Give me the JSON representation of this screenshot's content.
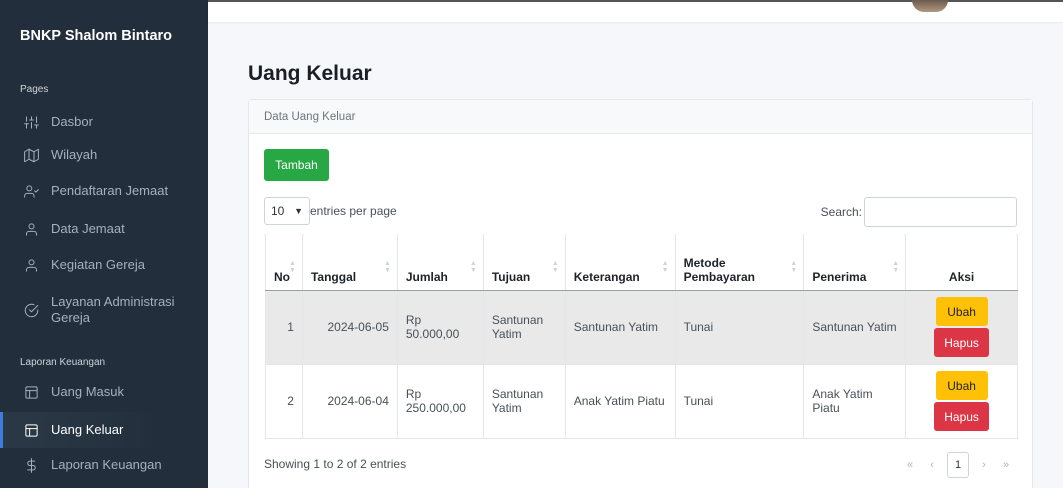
{
  "sidebar": {
    "brand": "BNKP Shalom Bintaro",
    "section_pages": "Pages",
    "section_laporan": "Laporan Keuangan",
    "items": [
      {
        "label": "Dasbor",
        "icon": "sliders-icon"
      },
      {
        "label": "Wilayah",
        "icon": "map-icon"
      },
      {
        "label": "Pendaftaran Jemaat",
        "icon": "user-check-icon"
      },
      {
        "label": "Data Jemaat",
        "icon": "user-icon"
      },
      {
        "label": "Kegiatan Gereja",
        "icon": "user-icon"
      },
      {
        "label": "Layanan Administrasi Gereja",
        "icon": "check-circle-icon"
      },
      {
        "label": "Uang Masuk",
        "icon": "table-icon"
      },
      {
        "label": "Uang Keluar",
        "icon": "table-icon",
        "active": true
      },
      {
        "label": "Laporan Keuangan",
        "icon": "dollar-icon"
      }
    ]
  },
  "main": {
    "title": "Uang Keluar",
    "card_title": "Data Uang Keluar",
    "add_button": "Tambah",
    "entries_value": "10",
    "entries_suffix": "entries per page",
    "search_label": "Search:",
    "search_value": "",
    "info": "Showing 1 to 2 of 2 entries",
    "pager": {
      "first": "«",
      "prev": "‹",
      "current": "1",
      "next": "›",
      "last": "»"
    }
  },
  "table": {
    "headers": [
      "No",
      "Tanggal",
      "Jumlah",
      "Tujuan",
      "Keterangan",
      "Metode Pembayaran",
      "Penerima",
      "Aksi"
    ],
    "rows": [
      {
        "no": "1",
        "tanggal": "2024-06-05",
        "jumlah": "Rp 50.000,00",
        "tujuan": "Santunan Yatim",
        "keterangan": "Santunan Yatim",
        "metode": "Tunai",
        "penerima": "Santunan Yatim",
        "ubah": "Ubah",
        "hapus": "Hapus"
      },
      {
        "no": "2",
        "tanggal": "2024-06-04",
        "jumlah": "Rp 250.000,00",
        "tujuan": "Santunan Yatim",
        "keterangan": "Anak Yatim Piatu",
        "metode": "Tunai",
        "penerima": "Anak Yatim Piatu",
        "ubah": "Ubah",
        "hapus": "Hapus"
      }
    ]
  },
  "colors": {
    "sidebar_bg": "#222e3c",
    "accent": "#3b7ddd",
    "add_button": "#28a745",
    "edit_button": "#ffc107",
    "delete_button": "#dc3545"
  }
}
